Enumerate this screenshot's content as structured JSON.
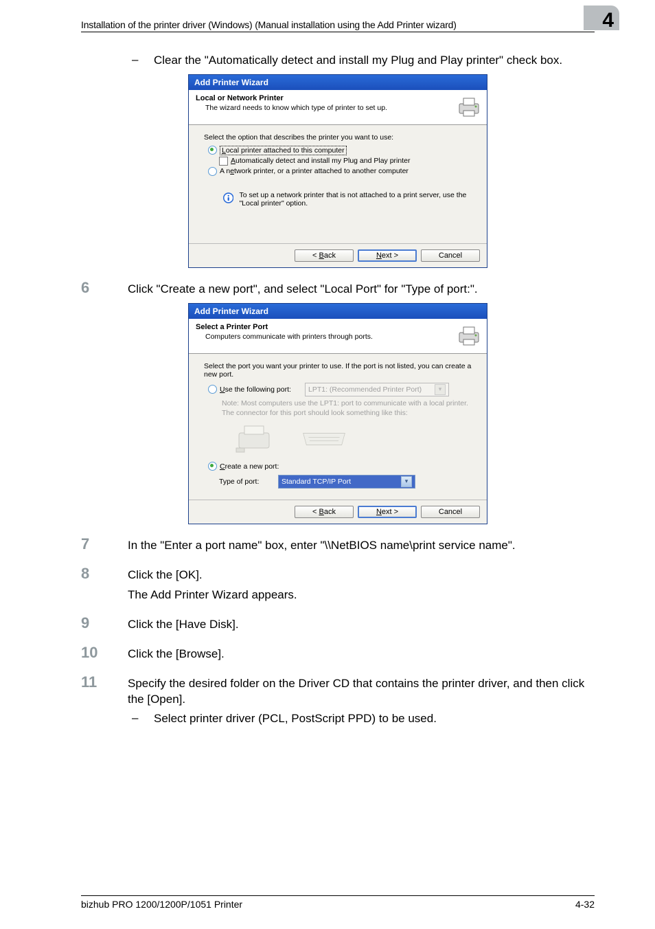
{
  "header": {
    "title": "Installation of the printer driver (Windows) (Manual installation using the Add Printer wizard)",
    "chapter": "4"
  },
  "intro": {
    "bullet": "–",
    "text": "Clear the \"Automatically detect and install my Plug and Play printer\" check box."
  },
  "wizard1": {
    "window_title": "Add Printer Wizard",
    "head_title": "Local or Network Printer",
    "head_sub": "The wizard needs to know which type of printer to set up.",
    "prompt": "Select the option that describes the printer you want to use:",
    "opt_local": "Local printer attached to this computer",
    "opt_auto": "Automatically detect and install my Plug and Play printer",
    "opt_network": "A network printer, or a printer attached to another computer",
    "info": "To set up a network printer that is not attached to a print server, use the \"Local printer\" option.",
    "btn_back": "< Back",
    "btn_next": "Next >",
    "btn_cancel": "Cancel"
  },
  "steps": {
    "s6": {
      "num": "6",
      "text": "Click \"Create a new port\", and select \"Local Port\" for \"Type of port:\"."
    }
  },
  "wizard2": {
    "window_title": "Add Printer Wizard",
    "head_title": "Select a Printer Port",
    "head_sub": "Computers communicate with printers through ports.",
    "prompt": "Select the port you want your printer to use.  If the port is not listed, you can create a new port.",
    "use_following": "Use the following port:",
    "lpt1": "LPT1: (Recommended Printer Port)",
    "note": "Note: Most computers use the LPT1: port to communicate with a local printer. The connector for this port should look something like this:",
    "create_new": "Create a new port:",
    "type_of_port": "Type of port:",
    "port_value": "Standard TCP/IP Port",
    "btn_back": "< Back",
    "btn_next": "Next >",
    "btn_cancel": "Cancel"
  },
  "steps2": {
    "s7": {
      "num": "7",
      "text": "In the \"Enter a port name\" box, enter \"\\\\NetBIOS name\\print service name\"."
    },
    "s8": {
      "num": "8",
      "text": "Click the [OK].",
      "sub": "The Add Printer Wizard appears."
    },
    "s9": {
      "num": "9",
      "text": "Click the [Have Disk]."
    },
    "s10": {
      "num": "10",
      "text": "Click the [Browse]."
    },
    "s11": {
      "num": "11",
      "text": "Specify the desired folder on the Driver CD that contains the printer driver, and then click the [Open].",
      "bullet_dash": "–",
      "bullet_text": "Select printer driver (PCL, PostScript PPD) to be used."
    }
  },
  "footer": {
    "left": "bizhub PRO 1200/1200P/1051 Printer",
    "right": "4-32"
  }
}
